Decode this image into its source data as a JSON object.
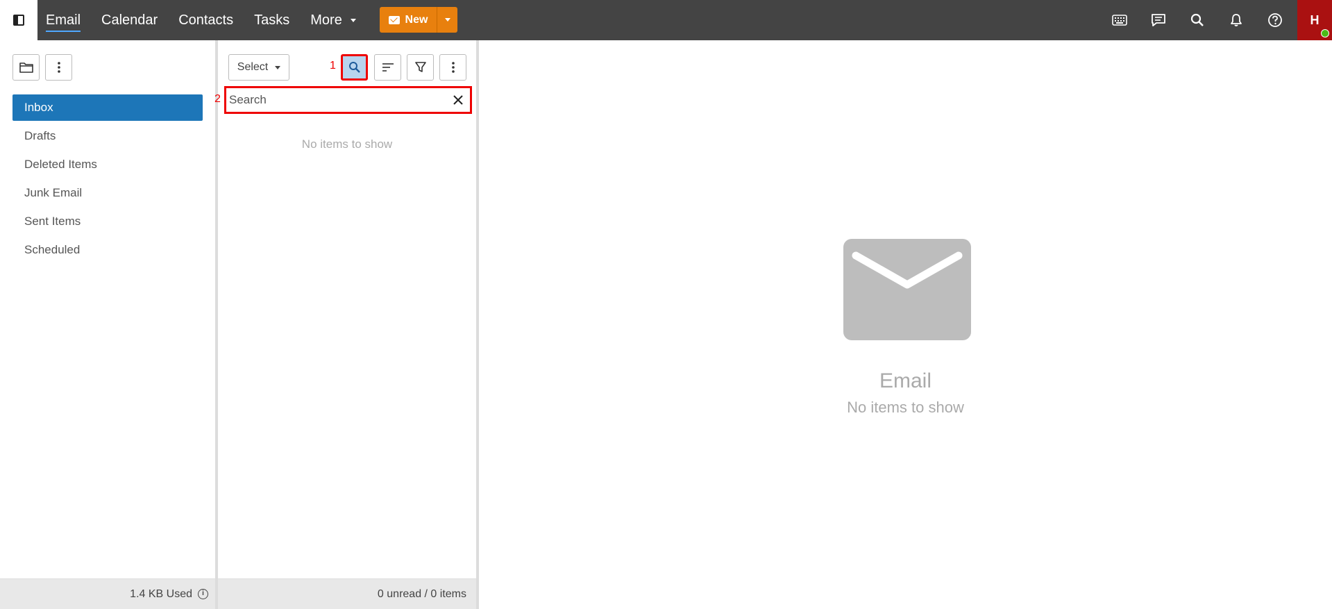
{
  "nav": {
    "items": [
      "Email",
      "Calendar",
      "Contacts",
      "Tasks"
    ],
    "more_label": "More",
    "new_label": "New"
  },
  "user": {
    "initial": "H",
    "status_color": "#4cbb17"
  },
  "top_icons": [
    "keyboard-icon",
    "chat-icon",
    "search-icon",
    "bell-icon",
    "help-icon"
  ],
  "folders": {
    "items": [
      "Inbox",
      "Drafts",
      "Deleted Items",
      "Junk Email",
      "Sent Items",
      "Scheduled"
    ],
    "active": "Inbox",
    "storage_used": "1.4 KB Used"
  },
  "list": {
    "select_label": "Select",
    "marker_1": "1",
    "marker_2": "2",
    "search_placeholder": "Search",
    "empty_text": "No items to show",
    "footer_status": "0 unread / 0 items"
  },
  "reading": {
    "title": "Email",
    "subtitle": "No items to show"
  },
  "colors": {
    "topbar": "#444444",
    "accent": "#e8800e",
    "active_folder": "#1d76b8",
    "highlight": "#ee0000"
  }
}
